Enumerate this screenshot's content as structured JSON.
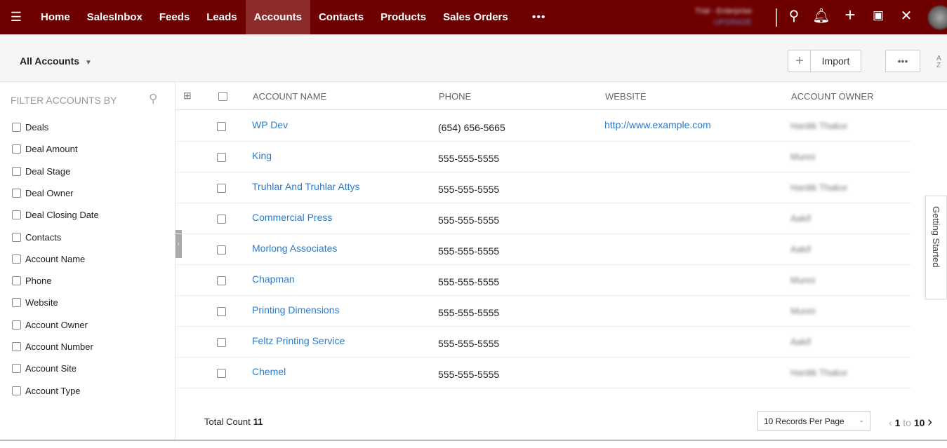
{
  "nav": {
    "items": [
      "Home",
      "SalesInbox",
      "Feeds",
      "Leads",
      "Accounts",
      "Contacts",
      "Products",
      "Sales Orders"
    ],
    "active": "Accounts",
    "more": "•••"
  },
  "trial": {
    "label": "Trial - Enterprise",
    "upgrade": "UPGRADE"
  },
  "toolbar": {
    "view": "All Accounts",
    "add": "+",
    "import": "Import",
    "more": "•••",
    "sort": "A Z"
  },
  "filter": {
    "title": "FILTER ACCOUNTS BY",
    "items": [
      "Deals",
      "Deal Amount",
      "Deal Stage",
      "Deal Owner",
      "Deal Closing Date",
      "Contacts",
      "Account Name",
      "Phone",
      "Website",
      "Account Owner",
      "Account Number",
      "Account Site",
      "Account Type"
    ]
  },
  "table": {
    "columns": [
      "ACCOUNT NAME",
      "PHONE",
      "WEBSITE",
      "ACCOUNT OWNER"
    ],
    "rows": [
      {
        "name": "WP Dev",
        "phone": "(654) 656-5665",
        "website": "http://www.example.com",
        "owner": "Hardik Thakor"
      },
      {
        "name": "King",
        "phone": "555-555-5555",
        "website": "",
        "owner": "Munni"
      },
      {
        "name": "Truhlar And Truhlar Attys",
        "phone": "555-555-5555",
        "website": "",
        "owner": "Hardik Thakor"
      },
      {
        "name": "Commercial Press",
        "phone": "555-555-5555",
        "website": "",
        "owner": "Aakif"
      },
      {
        "name": "Morlong Associates",
        "phone": "555-555-5555",
        "website": "",
        "owner": "Aakif"
      },
      {
        "name": "Chapman",
        "phone": "555-555-5555",
        "website": "",
        "owner": "Munni"
      },
      {
        "name": "Printing Dimensions",
        "phone": "555-555-5555",
        "website": "",
        "owner": "Munni"
      },
      {
        "name": "Feltz Printing Service",
        "phone": "555-555-5555",
        "website": "",
        "owner": "Aakif"
      },
      {
        "name": "Chemel",
        "phone": "555-555-5555",
        "website": "",
        "owner": "Hardik Thakor"
      }
    ]
  },
  "footer": {
    "total_label": "Total Count",
    "total": "11",
    "per_page": "10 Records Per Page",
    "from": "1",
    "to_label": "to",
    "to": "10"
  },
  "getting_started": "Getting Started"
}
